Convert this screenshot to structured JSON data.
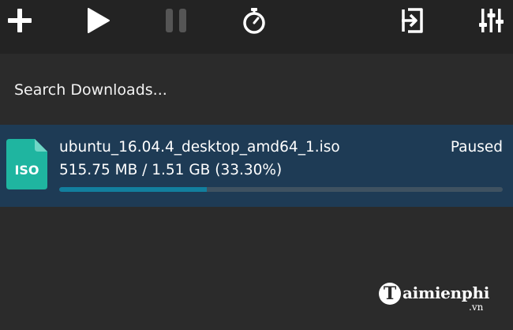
{
  "toolbar": {
    "buttons": [
      {
        "icon": "plus-icon",
        "label": "Add"
      },
      {
        "icon": "play-icon",
        "label": "Resume"
      },
      {
        "icon": "pause-icon",
        "label": "Pause"
      },
      {
        "icon": "stopwatch-icon",
        "label": "Schedule"
      },
      {
        "icon": "import-icon",
        "label": "Import"
      },
      {
        "icon": "sliders-icon",
        "label": "Settings"
      }
    ]
  },
  "search": {
    "placeholder": "Search Downloads..."
  },
  "downloads": [
    {
      "file_type": "ISO",
      "file_name": "ubuntu_16.04.4_desktop_amd64_1.iso",
      "status": "Paused",
      "size_text": "515.75 MB / 1.51 GB (33.30%)",
      "progress": 0.333
    }
  ],
  "watermark": {
    "initial": "T",
    "text": "aimienphi",
    "suffix": ".vn"
  },
  "colors": {
    "toolbar_bg": "#232323",
    "body_bg": "#2b2b2b",
    "selected_row_bg": "#1e3b55",
    "progress_fill": "#127f9e",
    "file_icon": "#1fb5a0"
  }
}
